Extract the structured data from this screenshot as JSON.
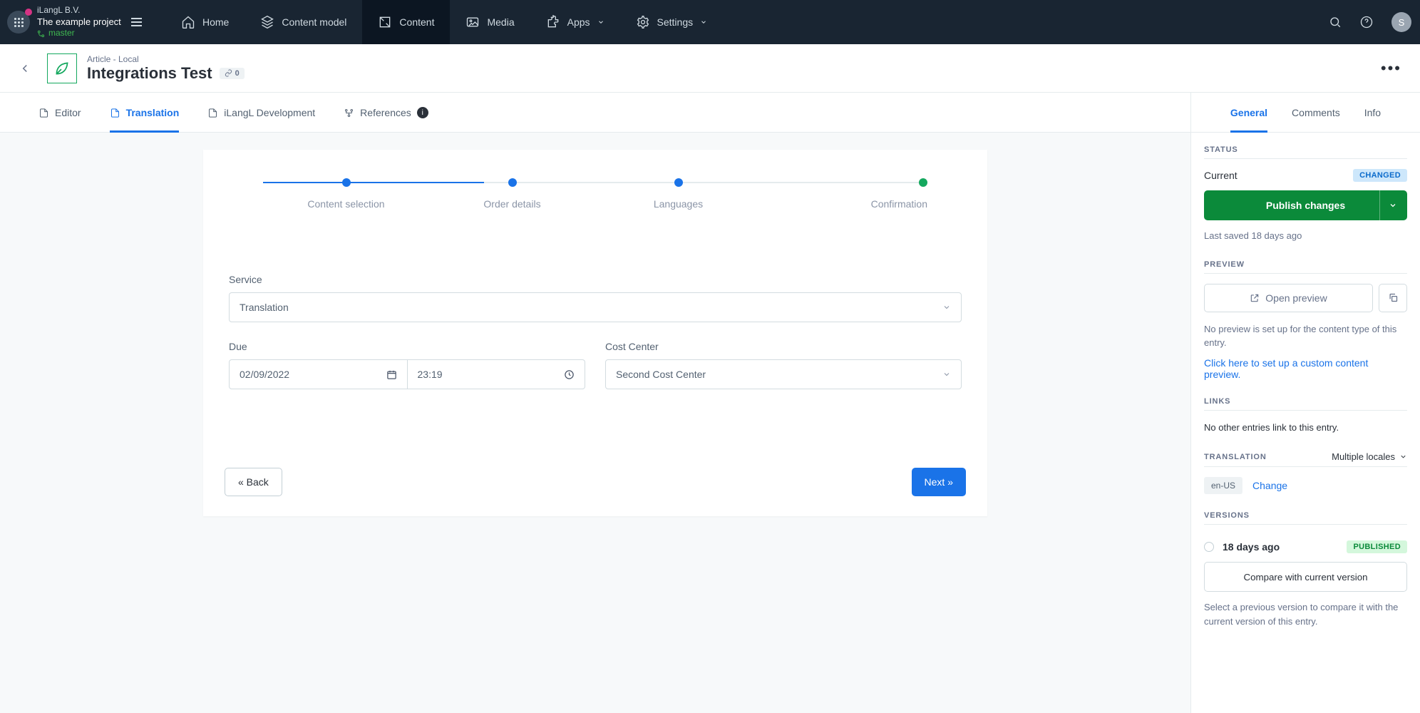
{
  "org": {
    "company": "iLangL B.V.",
    "project": "The example project",
    "branch": "master"
  },
  "nav": {
    "home": "Home",
    "content_model": "Content model",
    "content": "Content",
    "media": "Media",
    "apps": "Apps",
    "settings": "Settings"
  },
  "avatar_initial": "S",
  "entry": {
    "breadcrumb": "Article - Local",
    "title": "Integrations Test",
    "link_count": "0"
  },
  "tabs": {
    "editor": "Editor",
    "translation": "Translation",
    "ilangl": "iLangL Development",
    "references": "References"
  },
  "stepper": {
    "s1": "Content selection",
    "s2": "Order details",
    "s3": "Languages",
    "s4": "Confirmation"
  },
  "form": {
    "service_label": "Service",
    "service_value": "Translation",
    "due_label": "Due",
    "due_date": "02/09/2022",
    "due_time": "23:19",
    "cost_label": "Cost Center",
    "cost_value": "Second Cost Center",
    "back": "« Back",
    "next": "Next »"
  },
  "side_tabs": {
    "general": "General",
    "comments": "Comments",
    "info": "Info"
  },
  "status": {
    "heading": "STATUS",
    "current": "Current",
    "changed": "CHANGED",
    "publish": "Publish changes",
    "saved": "Last saved 18 days ago"
  },
  "preview": {
    "heading": "PREVIEW",
    "open": "Open preview",
    "msg": "No preview is set up for the content type of this entry.",
    "link": "Click here to set up a custom content preview."
  },
  "links": {
    "heading": "LINKS",
    "msg": "No other entries link to this entry."
  },
  "translation": {
    "heading": "TRANSLATION",
    "multi": "Multiple locales",
    "locale": "en-US",
    "change": "Change"
  },
  "versions": {
    "heading": "VERSIONS",
    "ago": "18 days ago",
    "published": "PUBLISHED",
    "compare": "Compare with current version",
    "msg": "Select a previous version to compare it with the current version of this entry."
  }
}
